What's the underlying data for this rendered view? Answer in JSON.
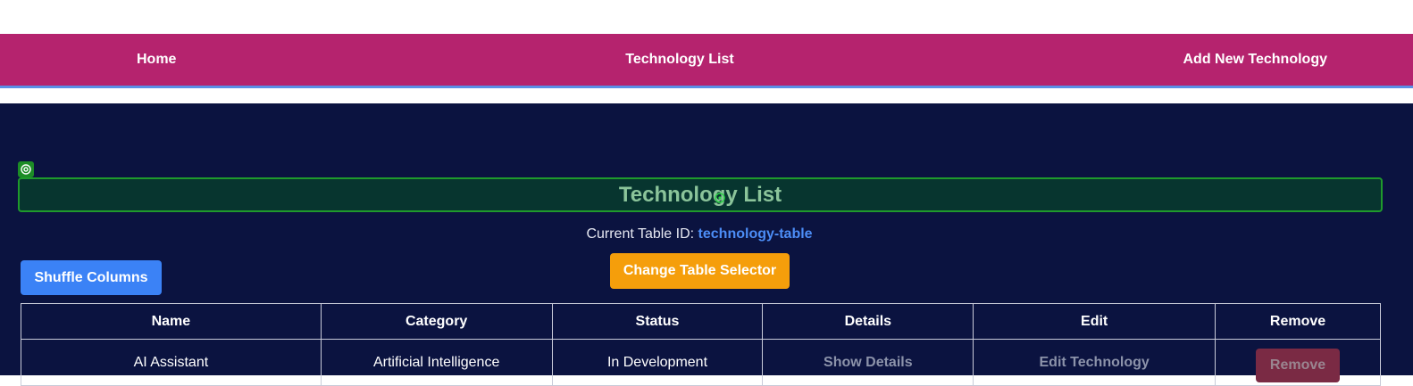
{
  "nav": {
    "home": "Home",
    "list": "Technology List",
    "add": "Add New Technology"
  },
  "page": {
    "title": "Technology List",
    "table_id_label": "Current Table ID:",
    "table_id_value": "technology-table"
  },
  "buttons": {
    "shuffle": "Shuffle Columns",
    "change_selector": "Change Table Selector"
  },
  "table": {
    "headers": [
      "Name",
      "Category",
      "Status",
      "Details",
      "Edit",
      "Remove"
    ],
    "rows": [
      {
        "name": "AI Assistant",
        "category": "Artificial Intelligence",
        "status": "In Development",
        "details": "Show Details",
        "edit": "Edit Technology",
        "remove": "Remove"
      }
    ]
  },
  "colors": {
    "navbar": "#b5236e",
    "main_bg": "#0b1340",
    "heading_border": "#1f9a2c",
    "shuffle_btn": "#3b82f6",
    "change_btn": "#f59e0b",
    "table_id_value": "#4c8df6"
  },
  "icons": {
    "badge": "target-icon",
    "cursor": "target-cursor-icon"
  }
}
